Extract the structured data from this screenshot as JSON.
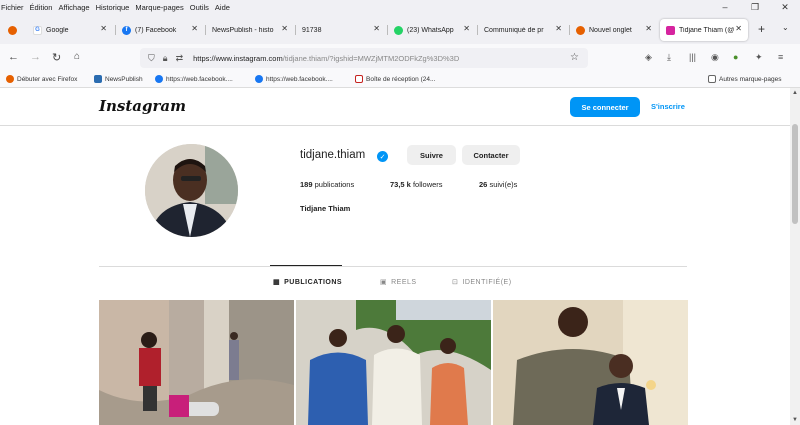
{
  "menubar": {
    "items": [
      "Fichier",
      "Édition",
      "Affichage",
      "Historique",
      "Marque-pages",
      "Outils",
      "Aide"
    ]
  },
  "tabs": [
    {
      "label": "",
      "icon": "firefox-pinned-icon"
    },
    {
      "label": "Google",
      "icon": "google-icon"
    },
    {
      "label": "(7) Facebook",
      "icon": "facebook-icon"
    },
    {
      "label": "NewsPublish - histo",
      "icon": "newspublish-icon"
    },
    {
      "label": "91738",
      "icon": "page-icon"
    },
    {
      "label": "(23) WhatsApp",
      "icon": "whatsapp-icon"
    },
    {
      "label": "Communiqué de pr",
      "icon": "page-icon"
    },
    {
      "label": "Nouvel onglet",
      "icon": "firefox-icon"
    },
    {
      "label": "Tidjane Thiam (@",
      "icon": "instagram-icon",
      "active": true
    }
  ],
  "navbar": {
    "url_host": "https://www.instagram.com",
    "url_path": "/tidjane.thiam/?igshid=MWZjMTM2ODFkZg%3D%3D"
  },
  "bookmarks": [
    {
      "label": "Débuter avec Firefox",
      "icon": "firefox-icon"
    },
    {
      "label": "NewsPublish",
      "icon": "newspublish-icon"
    },
    {
      "label": "https://web.facebook....",
      "icon": "facebook-icon"
    },
    {
      "label": "https://web.facebook....",
      "icon": "facebook-icon"
    },
    {
      "label": "Boîte de réception (24...",
      "icon": "gmail-icon"
    },
    {
      "label": "Autres marque-pages",
      "icon": "folder-icon"
    }
  ],
  "instagram": {
    "logo": "Instagram",
    "login_label": "Se connecter",
    "signup_label": "S'inscrire",
    "username": "tidjane.thiam",
    "follow_label": "Suivre",
    "contact_label": "Contacter",
    "stats": {
      "posts_count": "189",
      "posts_label": "publications",
      "followers_count": "73,5 k",
      "followers_label": "followers",
      "following_count": "26",
      "following_label": "suivi(e)s"
    },
    "full_name": "Tidjane Thiam",
    "profile_tabs": [
      {
        "label": "PUBLICATIONS",
        "icon": "grid-icon",
        "active": true
      },
      {
        "label": "REELS",
        "icon": "reels-icon"
      },
      {
        "label": "IDENTIFIÉ(E)",
        "icon": "tagged-icon"
      }
    ]
  },
  "colors": {
    "accent": "#0095f6",
    "facebook": "#1877f2",
    "whatsapp": "#25d366",
    "instagram": "#d6249f"
  }
}
